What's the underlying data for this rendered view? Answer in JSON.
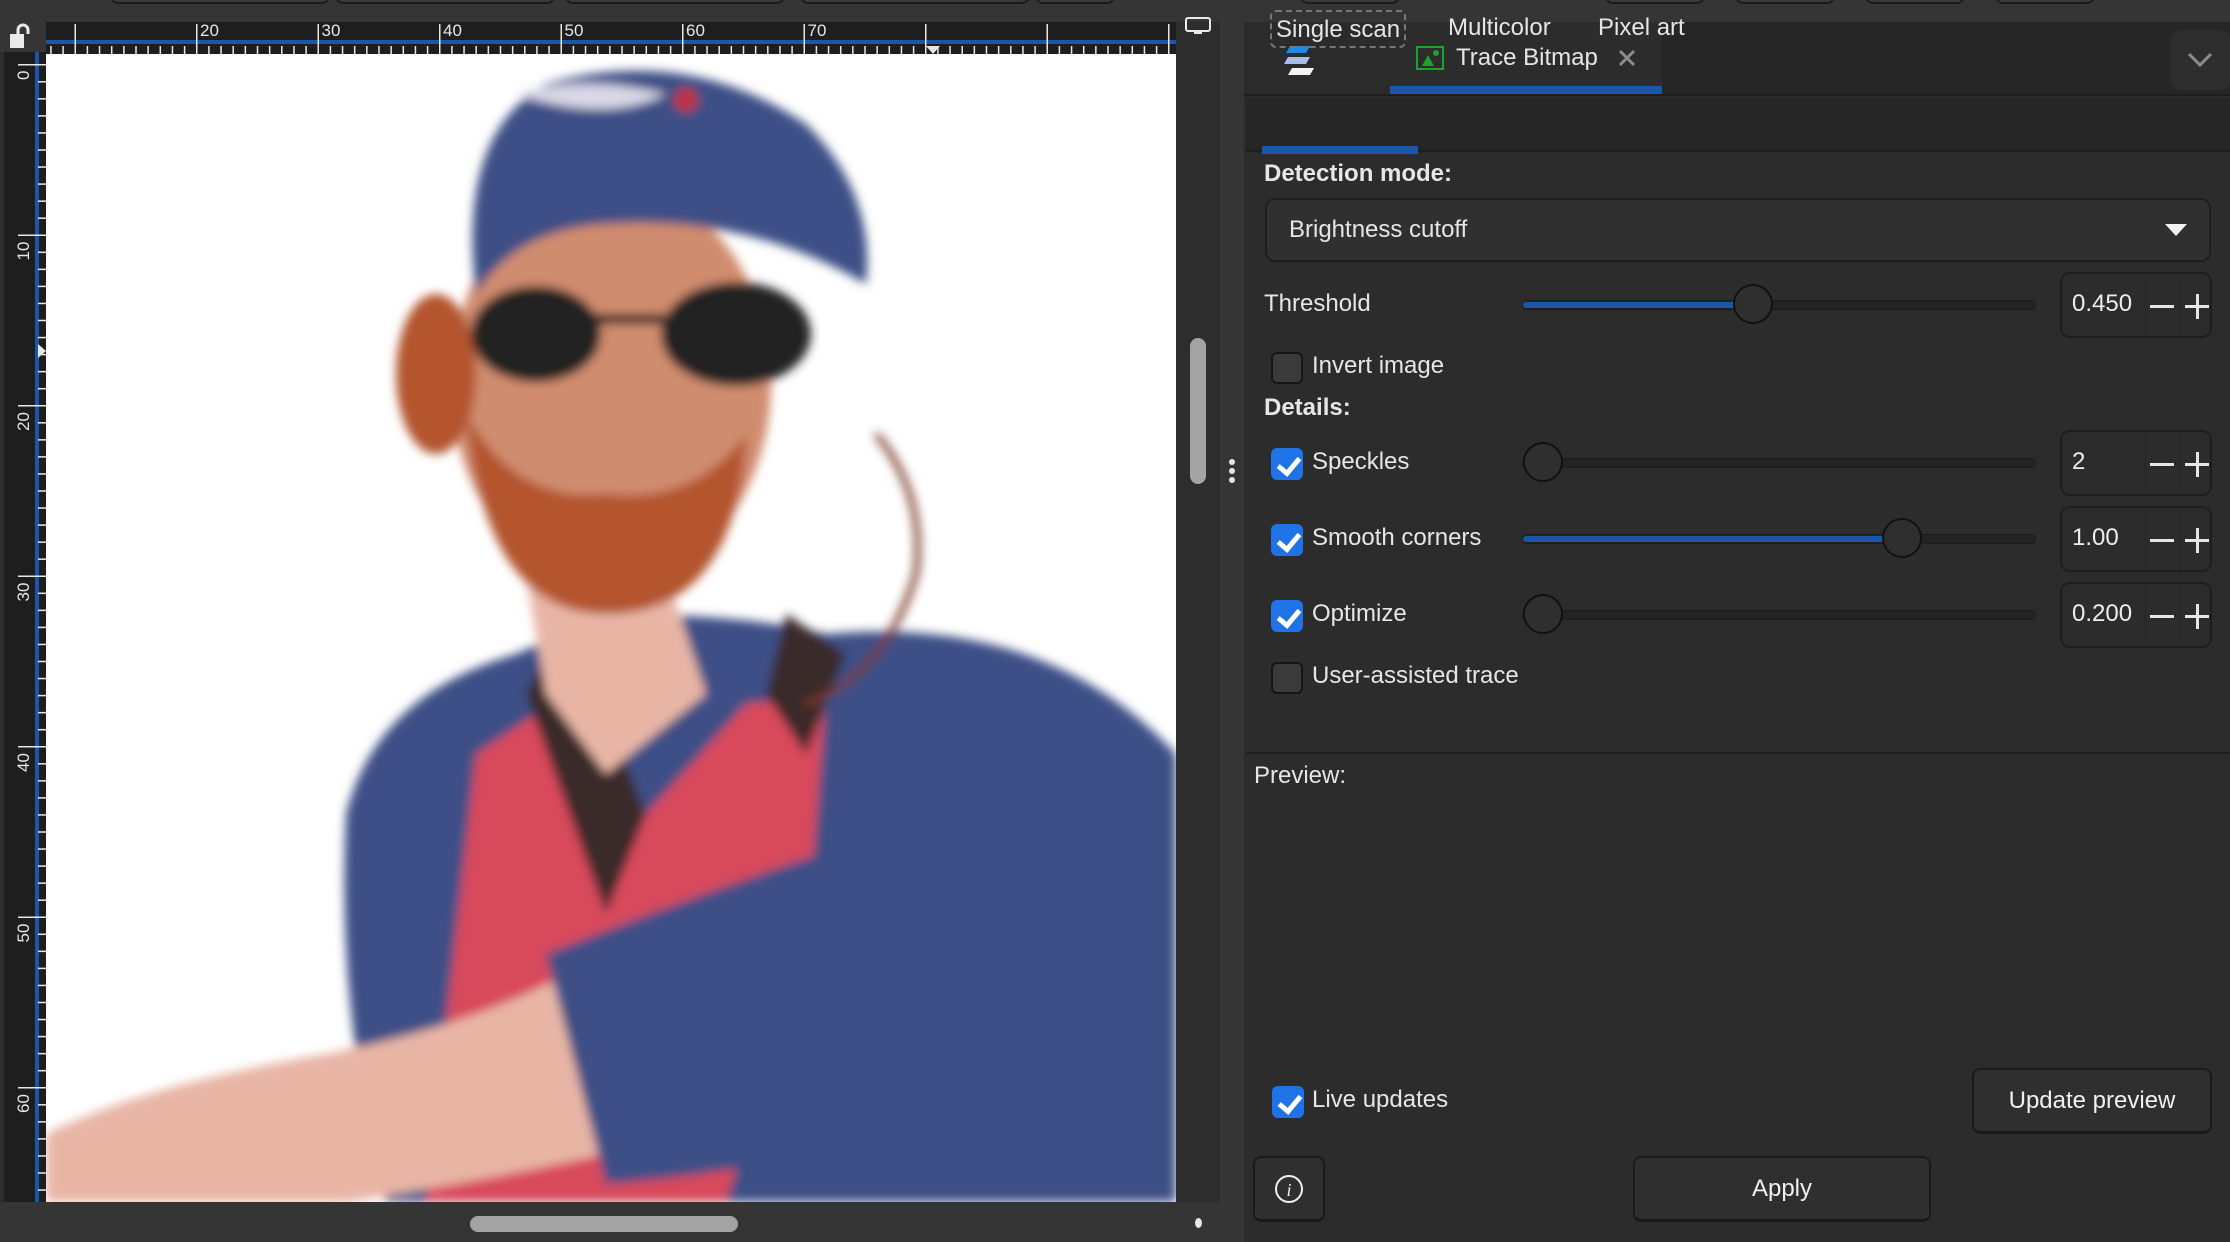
{
  "ruler": {
    "horizontal_labels": [
      "20",
      "30",
      "40",
      "50",
      "60",
      "70"
    ],
    "vertical_labels": [
      "0",
      "10",
      "20",
      "30",
      "40",
      "50",
      "60"
    ]
  },
  "canvas": {
    "image_description": "Bitmap photo of a bearded man wearing a blue baseball cap, sunglasses, blue long-sleeve shirt and red life vest"
  },
  "dock": {
    "tabs": [
      {
        "label": "Trace Bitmap",
        "icon": "image-icon",
        "active": true,
        "closable": true
      }
    ],
    "menu_icon": "dialog-stack-icon",
    "overflow_icon": "chevron-down-icon"
  },
  "trace": {
    "subtabs": [
      {
        "label": "Single scan",
        "active": true
      },
      {
        "label": "Multicolor",
        "active": false
      },
      {
        "label": "Pixel art",
        "active": false
      }
    ],
    "detection_mode_label": "Detection mode:",
    "detection_mode_value": "Brightness cutoff",
    "threshold": {
      "label": "Threshold",
      "value": "0.450",
      "fraction": 0.45
    },
    "invert_image": {
      "label": "Invert image",
      "checked": false
    },
    "details_label": "Details:",
    "speckles": {
      "label": "Speckles",
      "checked": true,
      "value": "2",
      "fraction": 0.0
    },
    "smooth_corners": {
      "label": "Smooth corners",
      "checked": true,
      "value": "1.00",
      "fraction": 0.74
    },
    "optimize": {
      "label": "Optimize",
      "checked": true,
      "value": "0.200",
      "fraction": 0.04
    },
    "user_assisted": {
      "label": "User-assisted trace",
      "checked": false
    },
    "preview_label": "Preview:",
    "live_updates": {
      "label": "Live updates",
      "checked": true
    },
    "update_preview_label": "Update preview",
    "apply_label": "Apply",
    "info_icon": "info-icon"
  },
  "colors": {
    "accent": "#1a57a8",
    "checkbox_on": "#1f73e6",
    "panel_bg": "#2c2c2c"
  }
}
